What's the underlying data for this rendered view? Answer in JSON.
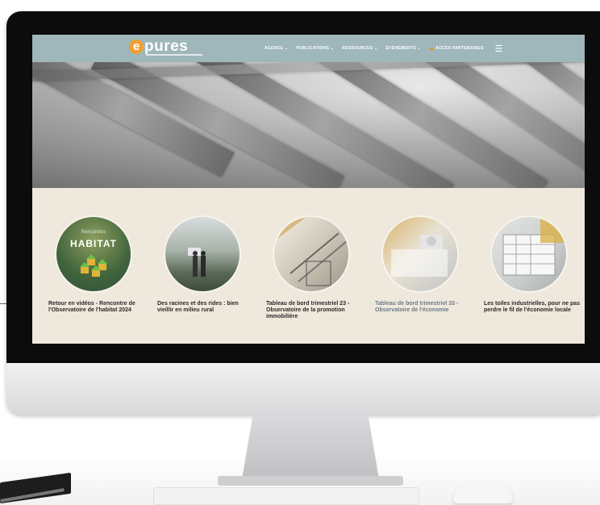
{
  "site": {
    "logo_text": "pures",
    "logo_letter": "e"
  },
  "nav": [
    {
      "label": "AGENCE ⌄"
    },
    {
      "label": "PUBLICATIONS ⌄"
    },
    {
      "label": "RESSOURCES ⌄"
    },
    {
      "label": "ÉVÉNEMENTS ⌄"
    },
    {
      "label": "🔒 ACCÈS PARTENAIRES"
    }
  ],
  "hamburger_icon": "☰",
  "cards": [
    {
      "title": "Retour en vidéos - Rencontre de l'Observatoire de l'habitat 2024",
      "badge": "HABITAT",
      "badge_top": "Rencontres",
      "muted": false
    },
    {
      "title": "Des racines et des rides : bien vieillir en milieu rural",
      "muted": false
    },
    {
      "title": "Tableau de bord trimestriel 23 - Observatoire de la promotion immobilière",
      "muted": false
    },
    {
      "title": "Tableau de bord trimestriel 33 - Observatoire de l'économie",
      "muted": true
    },
    {
      "title": "Les toiles industrielles, pour ne pas perdre le fil de l'économie locale",
      "muted": false
    }
  ],
  "colors": {
    "topbar": "#9fb6bb",
    "logo_accent": "#f0a030",
    "cards_bg": "#efe8dc"
  }
}
